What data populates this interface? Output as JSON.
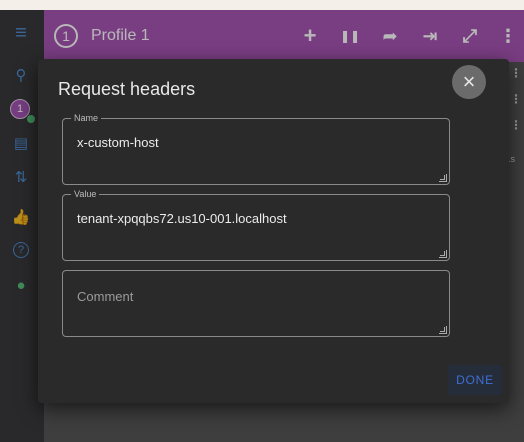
{
  "header": {
    "profile_number": "1",
    "profile_name": "Profile 1",
    "buttons": {
      "add": "+",
      "pause": "❚❚",
      "share": "➦",
      "login": "⇥",
      "expand": "⤢",
      "more": "⋮"
    }
  },
  "sidebar": {
    "menu_icon": "≡",
    "search_icon": "⚲",
    "profile_badge": "1",
    "add_file_icon": "▤",
    "sort_icon": "⇅",
    "like_icon": "👍",
    "help_icon": "?",
    "feedback_icon": "●"
  },
  "background": {
    "partial_text": ".s",
    "dots": "⋮"
  },
  "dialog": {
    "title": "Request headers",
    "close": "×",
    "name_label": "Name",
    "name_value": "x-custom-host",
    "value_label": "Value",
    "value_value": "tenant-xpqqbs72.us10-001.localhost",
    "comment_placeholder": "Comment",
    "done_label": "DONE"
  },
  "colors": {
    "header": "#a855b5",
    "dialog_bg": "#2a2a2b",
    "accent_blue": "#3d6fd4",
    "sidebar_bg": "#3a3a3c"
  }
}
